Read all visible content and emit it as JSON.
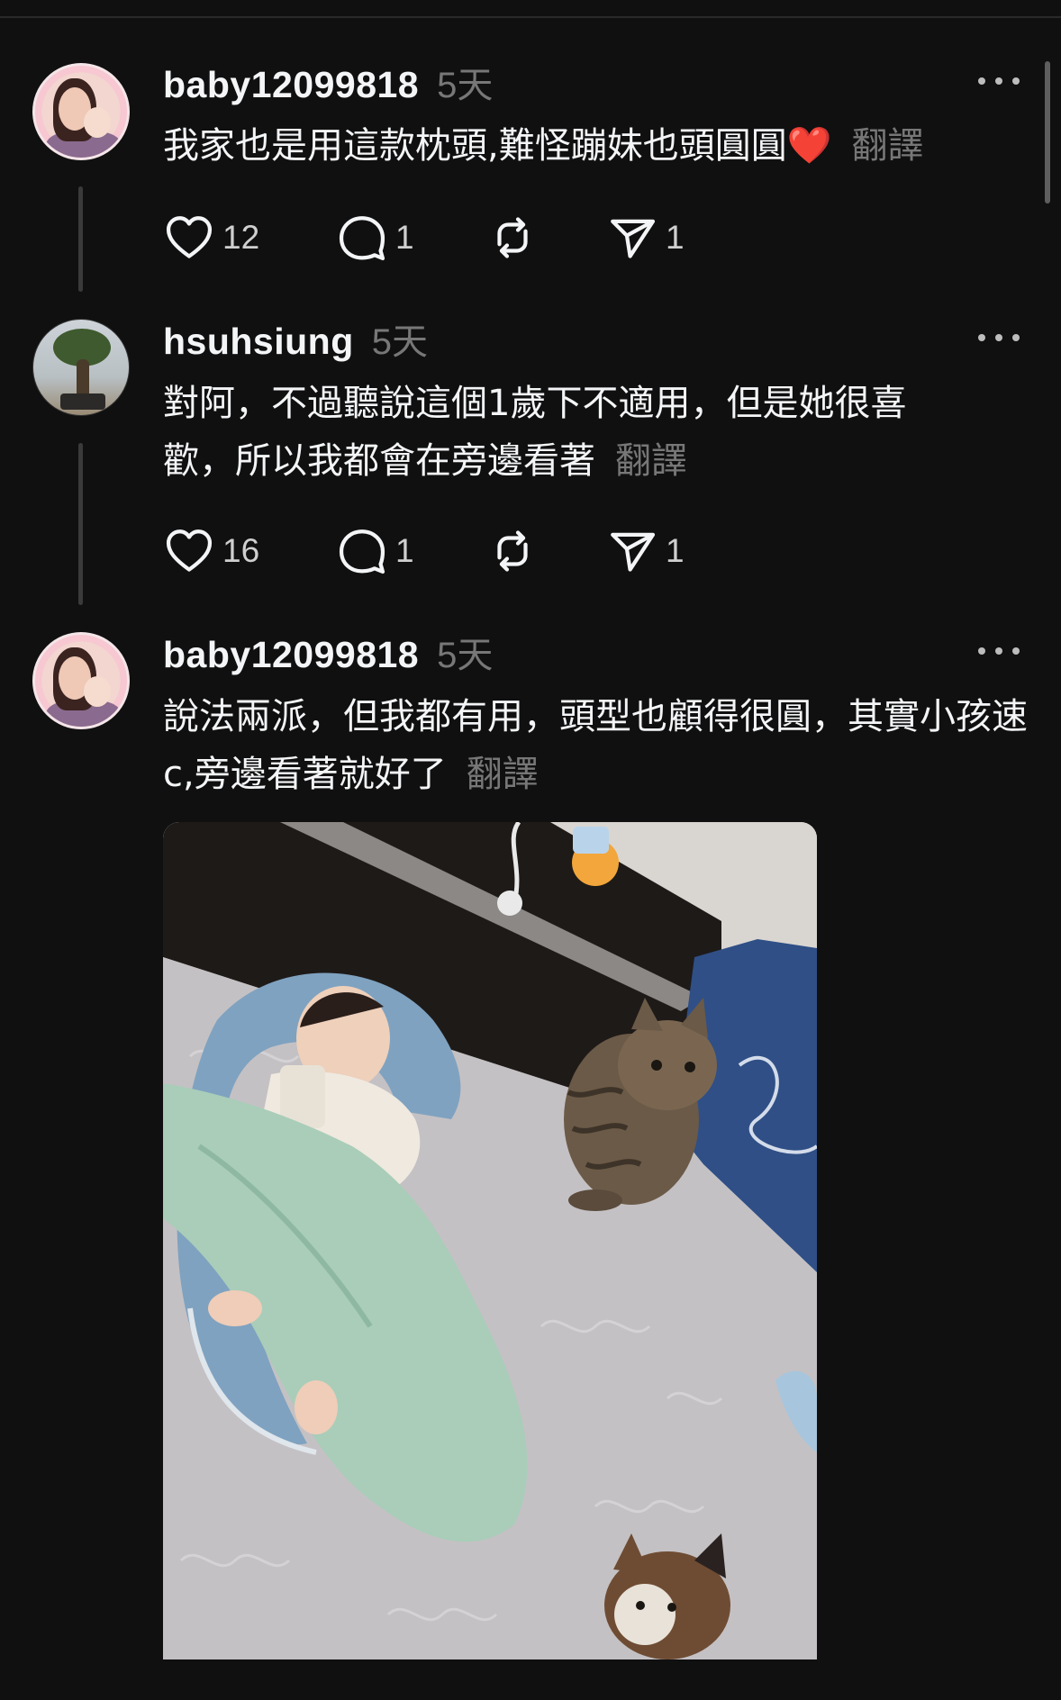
{
  "posts": [
    {
      "username": "baby12099818",
      "time": "5天",
      "text": "我家也是用這款枕頭,難怪蹦妹也頭圓圓❤️",
      "translate": "翻譯",
      "likes": "12",
      "comments": "1",
      "reposts": "",
      "shares": "1"
    },
    {
      "username": "hsuhsiung",
      "time": "5天",
      "text": "對阿，不過聽說這個1歲下不適用，但是她很喜歡，所以我都會在旁邊看著",
      "translate": "翻譯",
      "likes": "16",
      "comments": "1",
      "reposts": "",
      "shares": "1"
    },
    {
      "username": "baby12099818",
      "time": "5天",
      "text": "說法兩派，但我都有用，頭型也顧得很圓，其實小孩速c,旁邊看著就好了",
      "translate": "翻譯"
    }
  ],
  "icons": {
    "like": "heart-icon",
    "comment": "comment-bubble-icon",
    "repost": "repost-icon",
    "share": "send-icon",
    "more": "more-dots-icon"
  },
  "colors": {
    "background": "#101010",
    "text": "#f3f5f7",
    "muted": "#777777"
  }
}
